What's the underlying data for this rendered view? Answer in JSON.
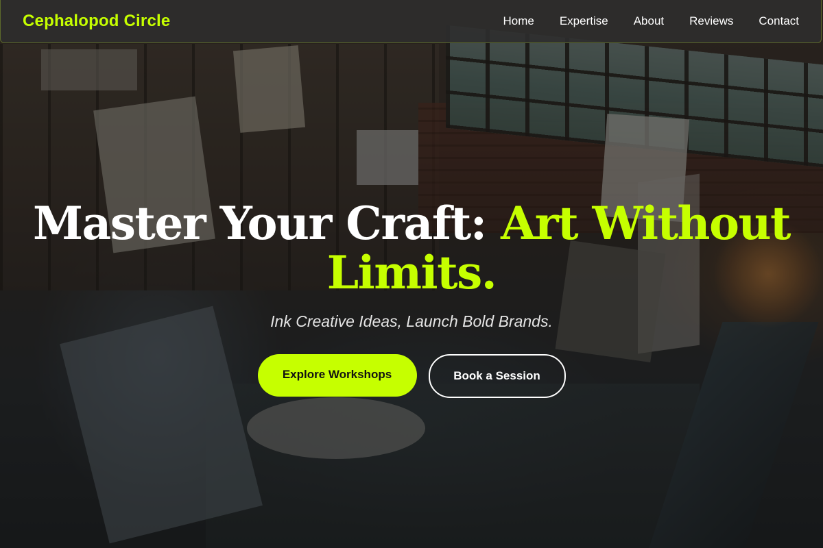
{
  "navbar": {
    "brand": "Cephalopod Circle",
    "links": [
      "Home",
      "Expertise",
      "About",
      "Reviews",
      "Contact"
    ]
  },
  "hero": {
    "title_white": "Master Your Craft: ",
    "title_accent": "Art Without Limits.",
    "subtitle": "Ink Creative Ideas, Launch Bold Brands.",
    "primary_button": "Explore Workshops",
    "secondary_button": "Book a Session"
  },
  "colors": {
    "accent": "#c6ff00",
    "navbar_bg": "#2d2d2d",
    "text_primary": "#ffffff"
  },
  "background": {
    "description_icon": "art-studio-photo"
  }
}
